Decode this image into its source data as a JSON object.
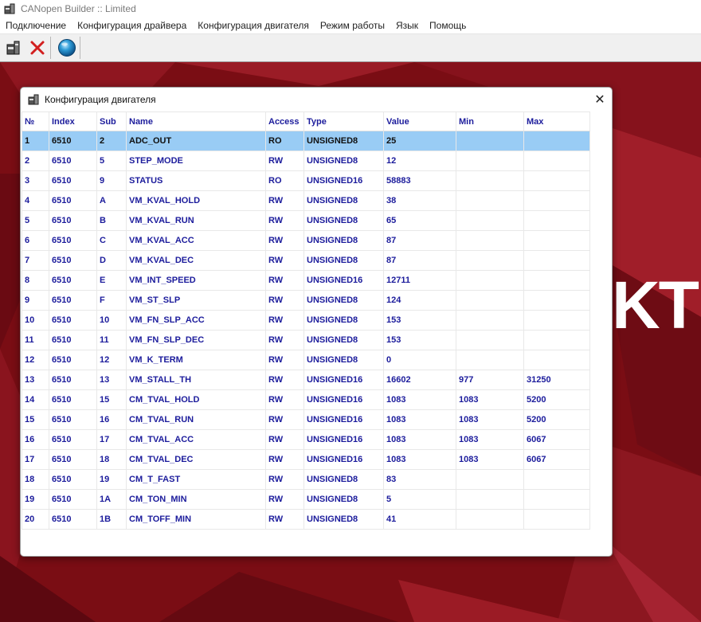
{
  "app": {
    "title": "CANopen Builder :: Limited"
  },
  "menu": [
    "Подключение",
    "Конфигурация драйвера",
    "Конфигурация двигателя",
    "Режим работы",
    "Язык",
    "Помощь"
  ],
  "toolbar": {
    "icons": [
      "connect-icon",
      "disconnect-icon",
      "globe-icon"
    ]
  },
  "background": {
    "logo_fragment": "KT"
  },
  "window": {
    "title": "Конфигурация двигателя",
    "close_glyph": "✕"
  },
  "table": {
    "columns": [
      "№",
      "Index",
      "Sub",
      "Name",
      "Access",
      "Type",
      "Value",
      "Min",
      "Max"
    ],
    "rows": [
      [
        "1",
        "6510",
        "2",
        "ADC_OUT",
        "RO",
        "UNSIGNED8",
        "25",
        "",
        ""
      ],
      [
        "2",
        "6510",
        "5",
        "STEP_MODE",
        "RW",
        "UNSIGNED8",
        "12",
        "",
        ""
      ],
      [
        "3",
        "6510",
        "9",
        "STATUS",
        "RO",
        "UNSIGNED16",
        "58883",
        "",
        ""
      ],
      [
        "4",
        "6510",
        "A",
        "VM_KVAL_HOLD",
        "RW",
        "UNSIGNED8",
        "38",
        "",
        ""
      ],
      [
        "5",
        "6510",
        "B",
        "VM_KVAL_RUN",
        "RW",
        "UNSIGNED8",
        "65",
        "",
        ""
      ],
      [
        "6",
        "6510",
        "C",
        "VM_KVAL_ACC",
        "RW",
        "UNSIGNED8",
        "87",
        "",
        ""
      ],
      [
        "7",
        "6510",
        "D",
        "VM_KVAL_DEC",
        "RW",
        "UNSIGNED8",
        "87",
        "",
        ""
      ],
      [
        "8",
        "6510",
        "E",
        "VM_INT_SPEED",
        "RW",
        "UNSIGNED16",
        "12711",
        "",
        ""
      ],
      [
        "9",
        "6510",
        "F",
        "VM_ST_SLP",
        "RW",
        "UNSIGNED8",
        "124",
        "",
        ""
      ],
      [
        "10",
        "6510",
        "10",
        "VM_FN_SLP_ACC",
        "RW",
        "UNSIGNED8",
        "153",
        "",
        ""
      ],
      [
        "11",
        "6510",
        "11",
        "VM_FN_SLP_DEC",
        "RW",
        "UNSIGNED8",
        "153",
        "",
        ""
      ],
      [
        "12",
        "6510",
        "12",
        "VM_K_TERM",
        "RW",
        "UNSIGNED8",
        "0",
        "",
        ""
      ],
      [
        "13",
        "6510",
        "13",
        "VM_STALL_TH",
        "RW",
        "UNSIGNED16",
        "16602",
        "977",
        "31250"
      ],
      [
        "14",
        "6510",
        "15",
        "CM_TVAL_HOLD",
        "RW",
        "UNSIGNED16",
        "1083",
        "1083",
        "5200"
      ],
      [
        "15",
        "6510",
        "16",
        "CM_TVAL_RUN",
        "RW",
        "UNSIGNED16",
        "1083",
        "1083",
        "5200"
      ],
      [
        "16",
        "6510",
        "17",
        "CM_TVAL_ACC",
        "RW",
        "UNSIGNED16",
        "1083",
        "1083",
        "6067"
      ],
      [
        "17",
        "6510",
        "18",
        "CM_TVAL_DEC",
        "RW",
        "UNSIGNED16",
        "1083",
        "1083",
        "6067"
      ],
      [
        "18",
        "6510",
        "19",
        "CM_T_FAST",
        "RW",
        "UNSIGNED8",
        "83",
        "",
        ""
      ],
      [
        "19",
        "6510",
        "1A",
        "CM_TON_MIN",
        "RW",
        "UNSIGNED8",
        "5",
        "",
        ""
      ],
      [
        "20",
        "6510",
        "1B",
        "CM_TOFF_MIN",
        "RW",
        "UNSIGNED8",
        "41",
        "",
        ""
      ]
    ],
    "selected_row": 0
  },
  "colors": {
    "text_blue": "#1c1c9c",
    "selection": "#99ccf5",
    "desktop_red": "#7a0d14"
  }
}
